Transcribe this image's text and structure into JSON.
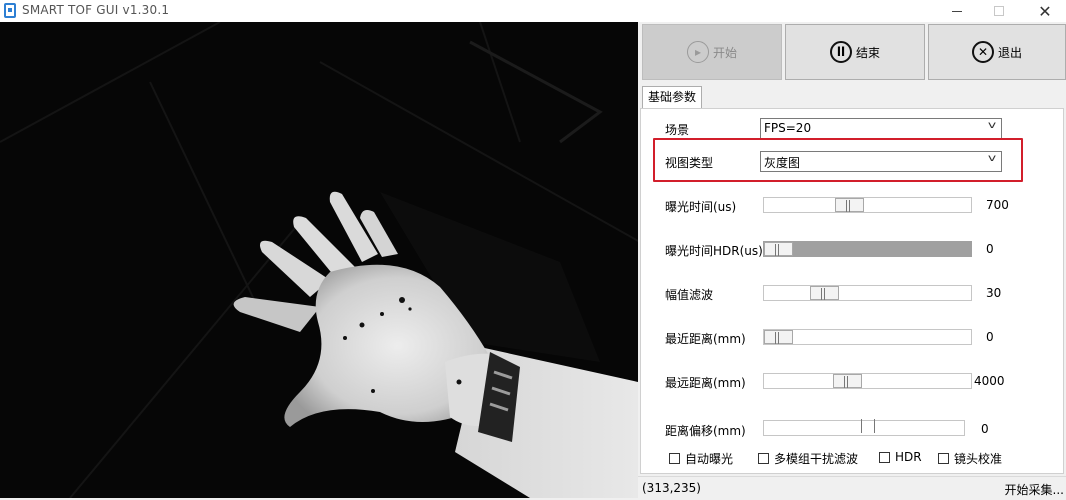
{
  "window": {
    "title": "SMART TOF GUI v1.30.1"
  },
  "buttons": {
    "start": "开始",
    "stop": "结束",
    "exit": "退出"
  },
  "tab": "基础参数",
  "scene": {
    "label": "场景",
    "value": "FPS=20"
  },
  "view_type": {
    "label": "视图类型",
    "value": "灰度图"
  },
  "sliders": [
    {
      "label": "曝光时间(us)",
      "value": "700",
      "position": 0.4,
      "disabled": false
    },
    {
      "label": "曝光时间HDR(us)",
      "value": "0",
      "position": 0.0,
      "disabled": true
    },
    {
      "label": "幅值滤波",
      "value": "30",
      "position": 0.26,
      "disabled": false
    },
    {
      "label": "最近距离(mm)",
      "value": "0",
      "position": 0.0,
      "disabled": false
    },
    {
      "label": "最远距离(mm)",
      "value": "4000",
      "position": 0.39,
      "disabled": false
    }
  ],
  "offset": {
    "label": "距离偏移(mm)",
    "value": "0",
    "position": 0.5
  },
  "checkboxes": [
    {
      "label": "自动曝光",
      "checked": false
    },
    {
      "label": "多模组干扰滤波",
      "checked": false
    },
    {
      "label": "HDR",
      "checked": false
    },
    {
      "label": "镜头校准",
      "checked": false
    }
  ],
  "status": {
    "coords": "(313,235)",
    "message": "开始采集..."
  },
  "colors": {
    "highlight": "#d21e2b",
    "disabled_slider": "#a0a0a0"
  }
}
